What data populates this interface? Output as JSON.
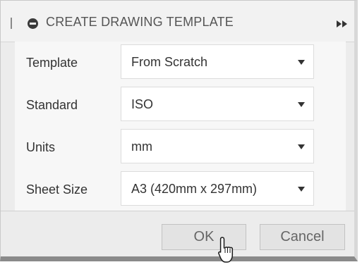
{
  "dialog": {
    "title": "CREATE DRAWING TEMPLATE",
    "icons": {
      "collapse": "collapse-icon",
      "expand": "double-chevron-right-icon"
    }
  },
  "fields": [
    {
      "label": "Template",
      "value": "From Scratch"
    },
    {
      "label": "Standard",
      "value": "ISO"
    },
    {
      "label": "Units",
      "value": "mm"
    },
    {
      "label": "Sheet Size",
      "value": "A3 (420mm x 297mm)"
    }
  ],
  "buttons": {
    "ok_label": "OK",
    "cancel_label": "Cancel"
  }
}
